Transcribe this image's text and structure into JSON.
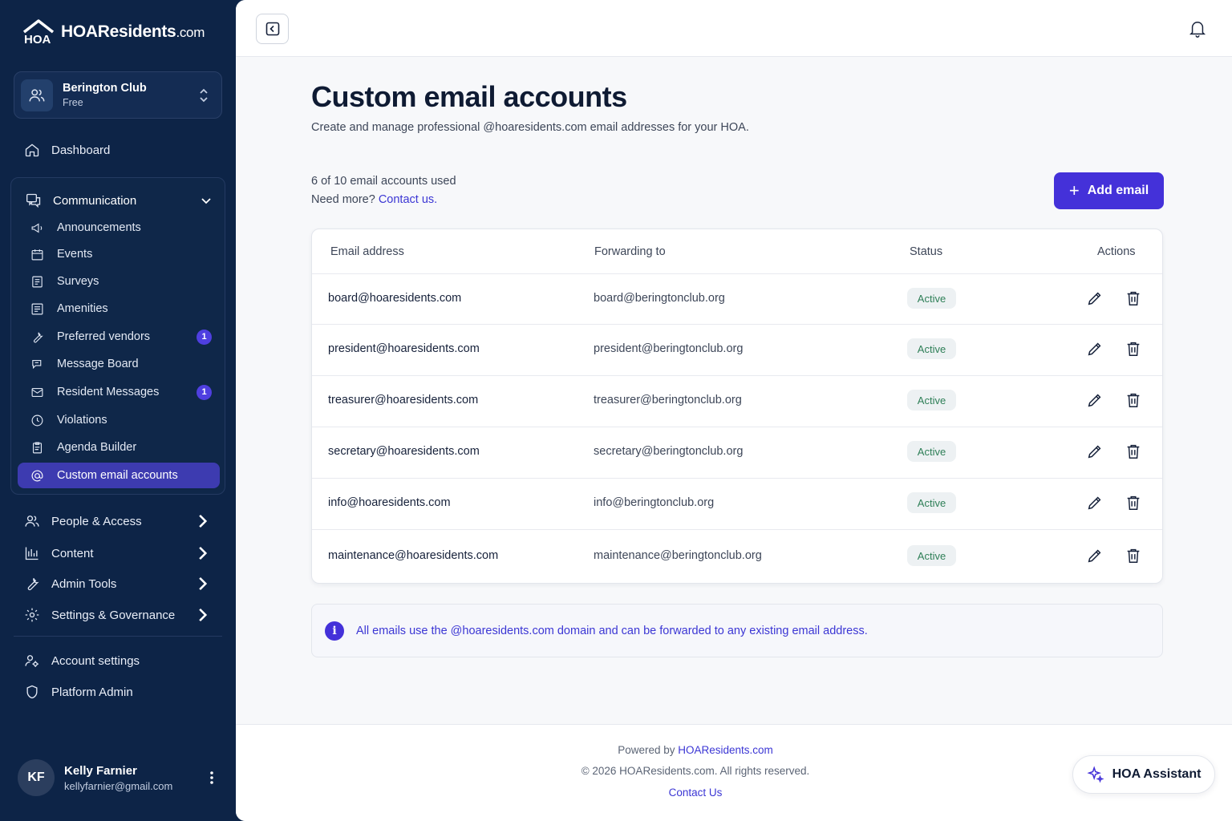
{
  "brand": {
    "name": "HOAResidents",
    "suffix": ".com"
  },
  "org": {
    "name": "Berington Club",
    "plan": "Free"
  },
  "nav": {
    "dashboard": "Dashboard",
    "communication": {
      "label": "Communication",
      "items": [
        {
          "label": "Announcements",
          "icon": "megaphone-icon"
        },
        {
          "label": "Events",
          "icon": "calendar-icon"
        },
        {
          "label": "Surveys",
          "icon": "survey-icon"
        },
        {
          "label": "Amenities",
          "icon": "amenities-icon"
        },
        {
          "label": "Preferred vendors",
          "icon": "wrench-icon",
          "badge": "1"
        },
        {
          "label": "Message Board",
          "icon": "chat-icon"
        },
        {
          "label": "Resident Messages",
          "icon": "mail-icon",
          "badge": "1"
        },
        {
          "label": "Violations",
          "icon": "clock-icon"
        },
        {
          "label": "Agenda Builder",
          "icon": "clipboard-icon"
        },
        {
          "label": "Custom email accounts",
          "icon": "at-icon",
          "active": true
        }
      ]
    },
    "sections": [
      {
        "label": "People & Access"
      },
      {
        "label": "Content"
      },
      {
        "label": "Admin Tools"
      },
      {
        "label": "Settings & Governance"
      }
    ],
    "account_settings": "Account settings",
    "platform_admin": "Platform Admin"
  },
  "user": {
    "initials": "KF",
    "name": "Kelly Farnier",
    "email": "kellyfarnier@gmail.com"
  },
  "page": {
    "title": "Custom email accounts",
    "subtitle": "Create and manage professional @hoaresidents.com email addresses for your HOA.",
    "usage": "6 of 10 email accounts used",
    "need_more": "Need more?",
    "contact_link": "Contact us.",
    "add_button": "Add email"
  },
  "table": {
    "headers": {
      "email": "Email address",
      "forwarding": "Forwarding to",
      "status": "Status",
      "actions": "Actions"
    },
    "rows": [
      {
        "email": "board@hoaresidents.com",
        "forwarding": "board@beringtonclub.org",
        "status": "Active"
      },
      {
        "email": "president@hoaresidents.com",
        "forwarding": "president@beringtonclub.org",
        "status": "Active"
      },
      {
        "email": "treasurer@hoaresidents.com",
        "forwarding": "treasurer@beringtonclub.org",
        "status": "Active"
      },
      {
        "email": "secretary@hoaresidents.com",
        "forwarding": "secretary@beringtonclub.org",
        "status": "Active"
      },
      {
        "email": "info@hoaresidents.com",
        "forwarding": "info@beringtonclub.org",
        "status": "Active"
      },
      {
        "email": "maintenance@hoaresidents.com",
        "forwarding": "maintenance@beringtonclub.org",
        "status": "Active"
      }
    ]
  },
  "info": {
    "text": "All emails use the @hoaresidents.com domain and can be forwarded to any existing email address."
  },
  "footer": {
    "powered_by": "Powered by",
    "powered_link": "HOAResidents.com",
    "copyright": "© 2026 HOAResidents.com. All rights reserved.",
    "contact": "Contact Us"
  },
  "assistant": {
    "label": "HOA Assistant"
  },
  "colors": {
    "sidebar": "#0d2447",
    "accent": "#4431d9",
    "active_item": "#3d3bb0",
    "status_text": "#2e7f57"
  }
}
